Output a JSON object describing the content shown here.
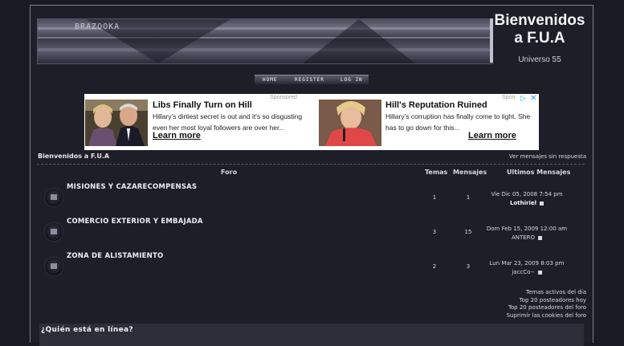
{
  "header": {
    "banner_text": "BRAZOOKA",
    "title_line1": "Bienvenidos",
    "title_line2": "a F.U.A",
    "subtitle": "Universo 55"
  },
  "nav": {
    "items": [
      "HOME",
      "REGISTER",
      "LOG IN"
    ]
  },
  "ad": {
    "sponsored_left": "Sponsored",
    "sponsored_right": "Spon",
    "left": {
      "headline": "Libs Finally Turn on Hill",
      "body": "Hillary's dirtiest secret is out and it's so disgusting even her most loyal followers are over her...",
      "cta": "Learn more"
    },
    "right": {
      "headline": "Hill's Reputation Ruined",
      "body": "Hillary's corruption has finally come to light. She has to go down for this...",
      "cta": "Learn more"
    },
    "accent_color": "#2aa7e0"
  },
  "breadcrumb": "Bienvenidos a F.U.A",
  "unanswered_link": "Ver mensajes sin respuesta",
  "table": {
    "headers": {
      "forum": "Foro",
      "topics": "Temas",
      "posts": "Mensajes",
      "last": "Ultimos Mensajes"
    },
    "rows": [
      {
        "name": "MISIONES Y CAZARECOMPENSAS",
        "topics": "1",
        "posts": "1",
        "last_date": "Vie Dic 05, 2008 7:54 pm",
        "last_user": "Lothiriel"
      },
      {
        "name": "COMERCIO EXTERIOR Y EMBAJADA",
        "topics": "3",
        "posts": "15",
        "last_date": "Dom Feb 15, 2009 12:00 am",
        "last_user": "ANTERO"
      },
      {
        "name": "ZONA DE ALISTAMIENTO",
        "topics": "2",
        "posts": "3",
        "last_date": "Lun Mar 23, 2009 8:03 pm",
        "last_user": "jaccCo--"
      }
    ]
  },
  "footer_links": [
    "Temas activos del día",
    "Top 20 posteadores hoy",
    "Top 20 posteadores del foro",
    "Suprimir las cookies del foro"
  ],
  "online_title": "¿Quién está en línea?"
}
